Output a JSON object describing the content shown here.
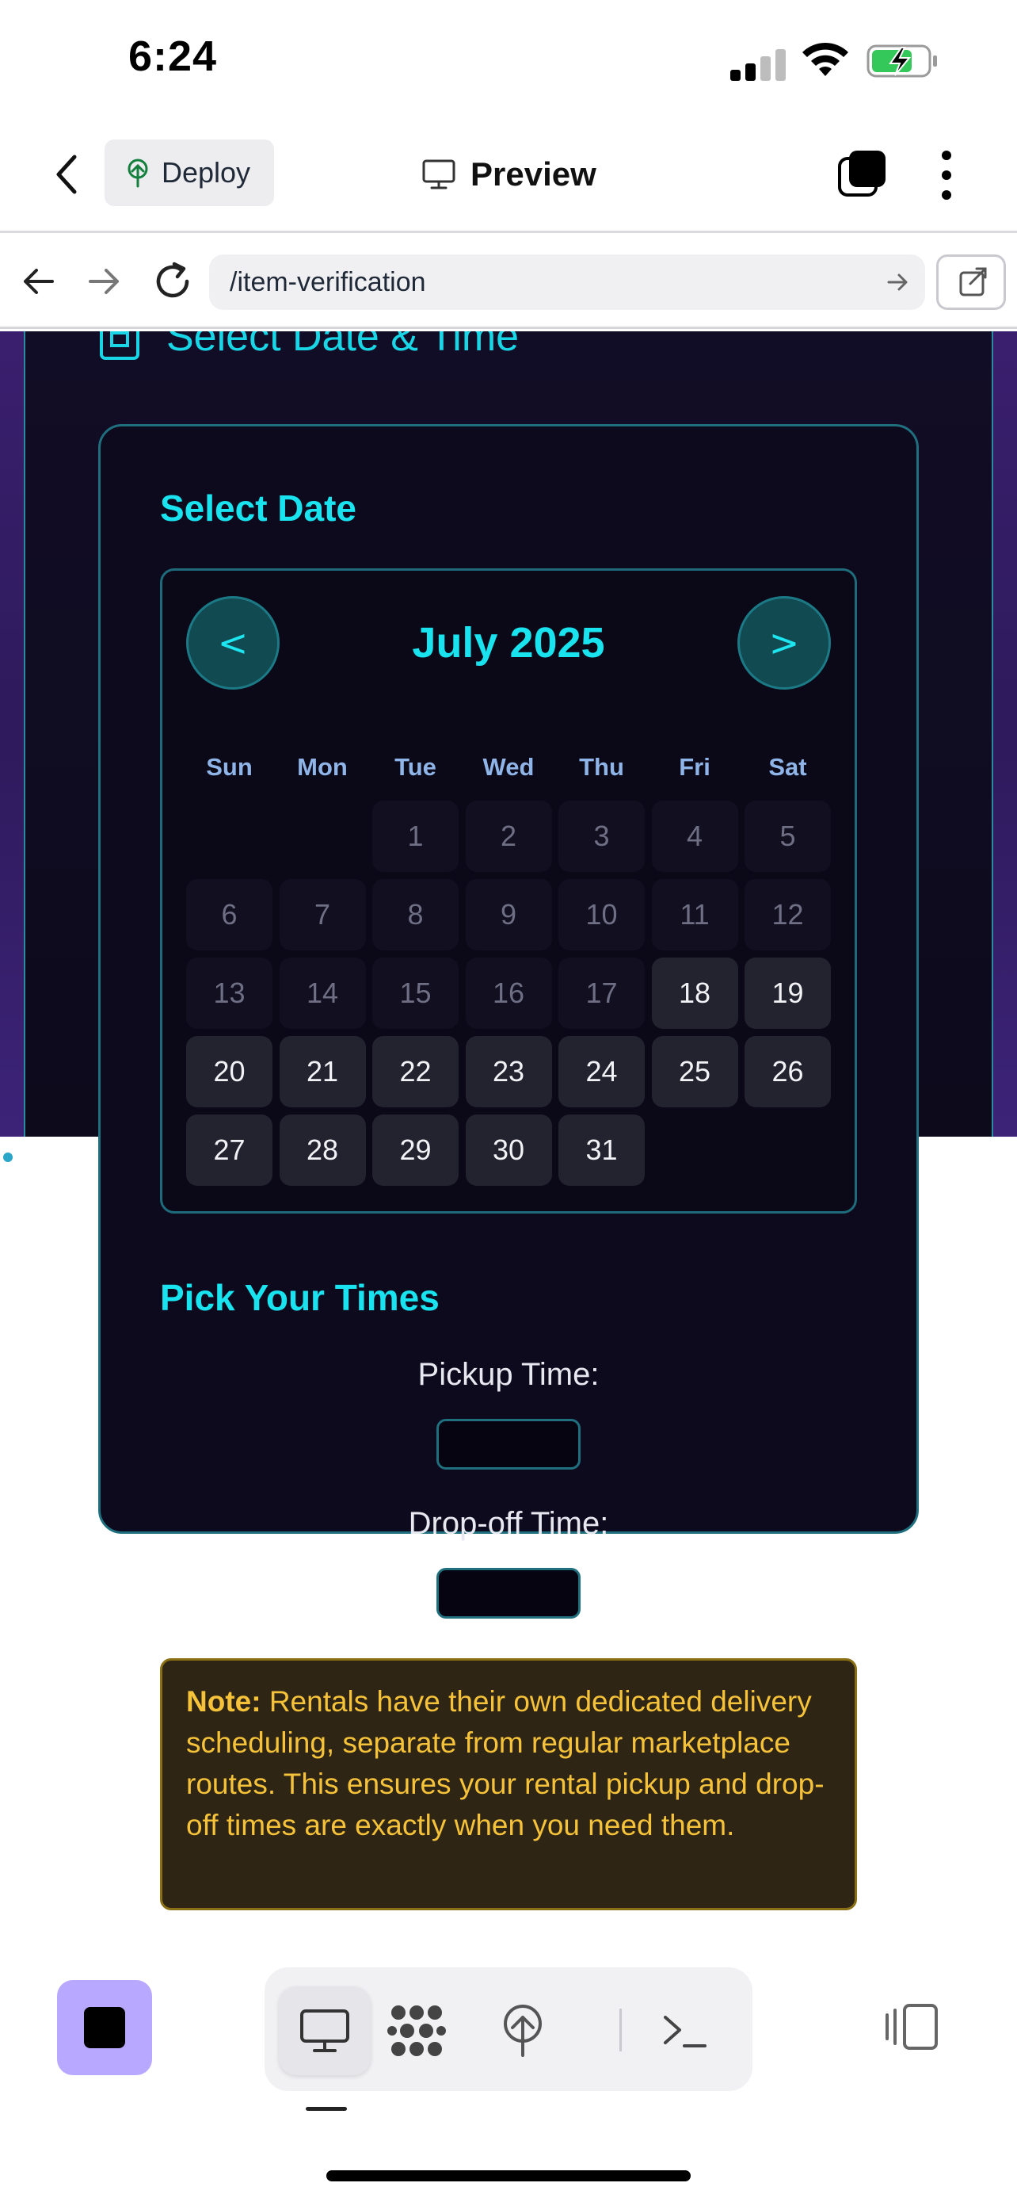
{
  "status_bar": {
    "time": "6:24"
  },
  "toolbar": {
    "deploy_label": "Deploy",
    "preview_label": "Preview"
  },
  "browser": {
    "url": "/item-verification"
  },
  "page": {
    "section_title": "Select Date & Time",
    "select_date_heading": "Select Date",
    "calendar": {
      "prev_label": "<",
      "next_label": ">",
      "month_label": "July 2025",
      "weekdays": [
        "Sun",
        "Mon",
        "Tue",
        "Wed",
        "Thu",
        "Fri",
        "Sat"
      ],
      "leading_blank_days": 2,
      "days": [
        {
          "n": "1",
          "available": false
        },
        {
          "n": "2",
          "available": false
        },
        {
          "n": "3",
          "available": false
        },
        {
          "n": "4",
          "available": false
        },
        {
          "n": "5",
          "available": false
        },
        {
          "n": "6",
          "available": false
        },
        {
          "n": "7",
          "available": false
        },
        {
          "n": "8",
          "available": false
        },
        {
          "n": "9",
          "available": false
        },
        {
          "n": "10",
          "available": false
        },
        {
          "n": "11",
          "available": false
        },
        {
          "n": "12",
          "available": false
        },
        {
          "n": "13",
          "available": false
        },
        {
          "n": "14",
          "available": false
        },
        {
          "n": "15",
          "available": false
        },
        {
          "n": "16",
          "available": false
        },
        {
          "n": "17",
          "available": false
        },
        {
          "n": "18",
          "available": true
        },
        {
          "n": "19",
          "available": true
        },
        {
          "n": "20",
          "available": true
        },
        {
          "n": "21",
          "available": true
        },
        {
          "n": "22",
          "available": true
        },
        {
          "n": "23",
          "available": true
        },
        {
          "n": "24",
          "available": true
        },
        {
          "n": "25",
          "available": true
        },
        {
          "n": "26",
          "available": true
        },
        {
          "n": "27",
          "available": true
        },
        {
          "n": "28",
          "available": true
        },
        {
          "n": "29",
          "available": true
        },
        {
          "n": "30",
          "available": true
        },
        {
          "n": "31",
          "available": true
        }
      ]
    },
    "pick_times_heading": "Pick Your Times",
    "pickup_label": "Pickup Time:",
    "pickup_value": "",
    "dropoff_label": "Drop-off Time:",
    "dropoff_value": "",
    "note_label": "Note:",
    "note_text": " Rentals have their own dedicated delivery scheduling, separate from regular marketplace routes. This ensures your rental pickup and drop-off times are exactly when you need them."
  },
  "bottom_bar": {
    "modes": [
      "preview-icon",
      "grid-icon",
      "deploy-icon",
      "terminal-icon"
    ],
    "active_mode": "preview-icon"
  },
  "colors": {
    "accent_cyan": "#18e3ef",
    "note_text": "#f5c23a",
    "stop_button": "#b9a8ff",
    "page_background": "#2e1a5c"
  }
}
